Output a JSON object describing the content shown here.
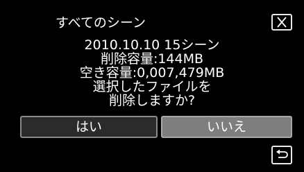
{
  "dialog": {
    "title": "すべてのシーン",
    "close_icon": "close-icon",
    "message_lines": [
      "2010.10.10 15シーン",
      "削除容量:144MB",
      "空き容量:0,007,479MB",
      "選択したファイルを",
      "削除しますか?"
    ],
    "yes_label": "はい",
    "no_label": "いいえ",
    "back_icon": "return-arrow-icon"
  },
  "colors": {
    "background": "#000000",
    "text": "#ffffff",
    "yes_button": "#2b2b2b",
    "no_button_selected": "#7e7e7e"
  }
}
